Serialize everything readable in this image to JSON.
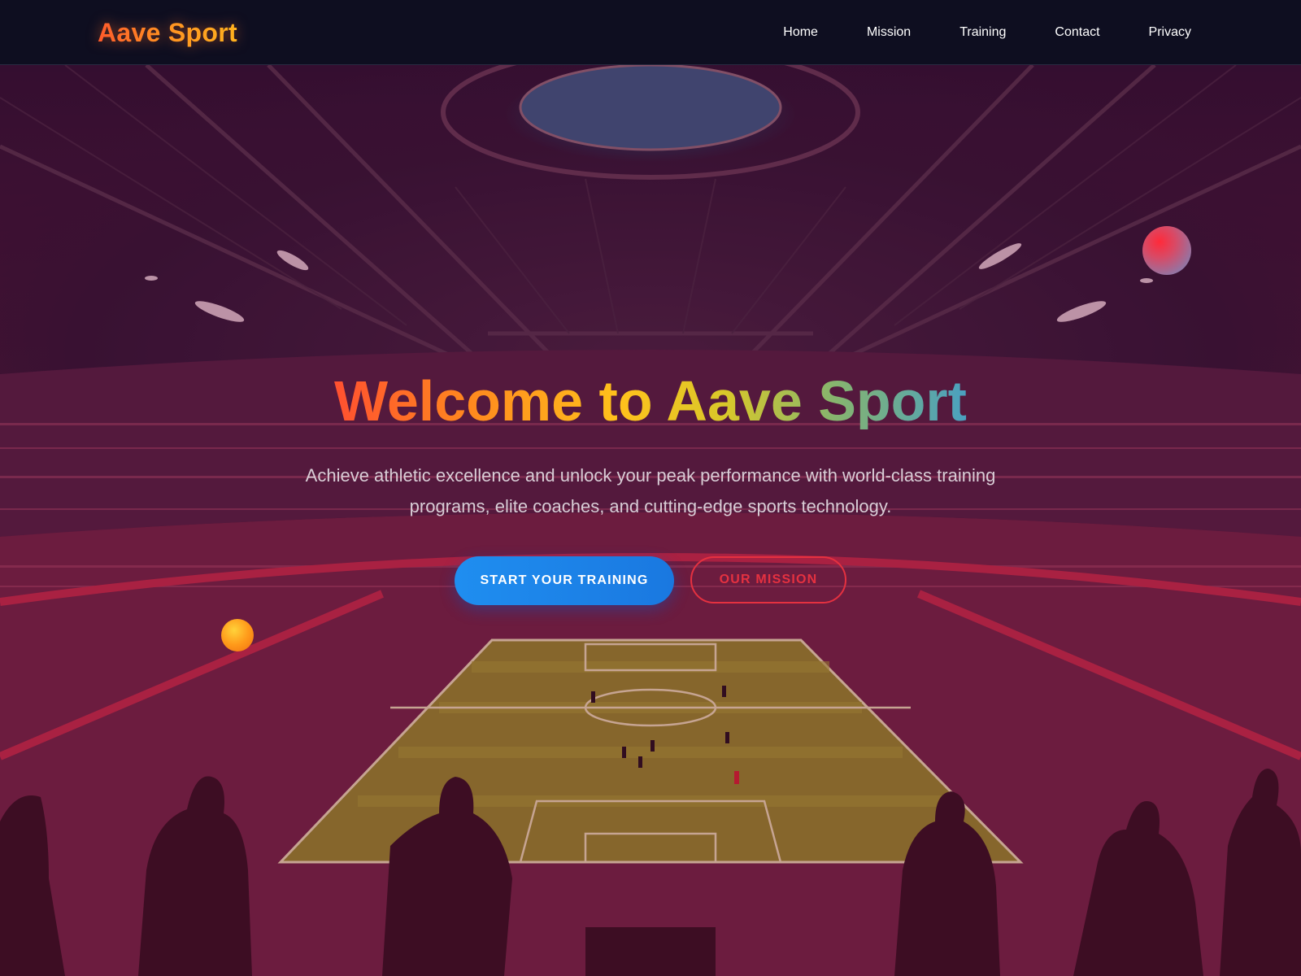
{
  "nav": {
    "logo": "Aave Sport",
    "links": [
      {
        "label": "Home"
      },
      {
        "label": "Mission"
      },
      {
        "label": "Training"
      },
      {
        "label": "Contact"
      },
      {
        "label": "Privacy"
      }
    ]
  },
  "hero": {
    "title": "Welcome to Aave Sport",
    "subtitle": "Achieve athletic excellence and unlock your peak performance with world-class training programs, elite coaches, and cutting-edge sports technology.",
    "primary_button": "START YOUR TRAINING",
    "secondary_button": "OUR MISSION"
  },
  "colors": {
    "nav_background": "#0e0e20",
    "primary_button": "#1f8ef0",
    "secondary_button_border": "#e53140",
    "overlay": "#6e0a32"
  },
  "icons": {
    "orb_right": "floating-orb-icon",
    "orb_left": "floating-ball-icon"
  }
}
